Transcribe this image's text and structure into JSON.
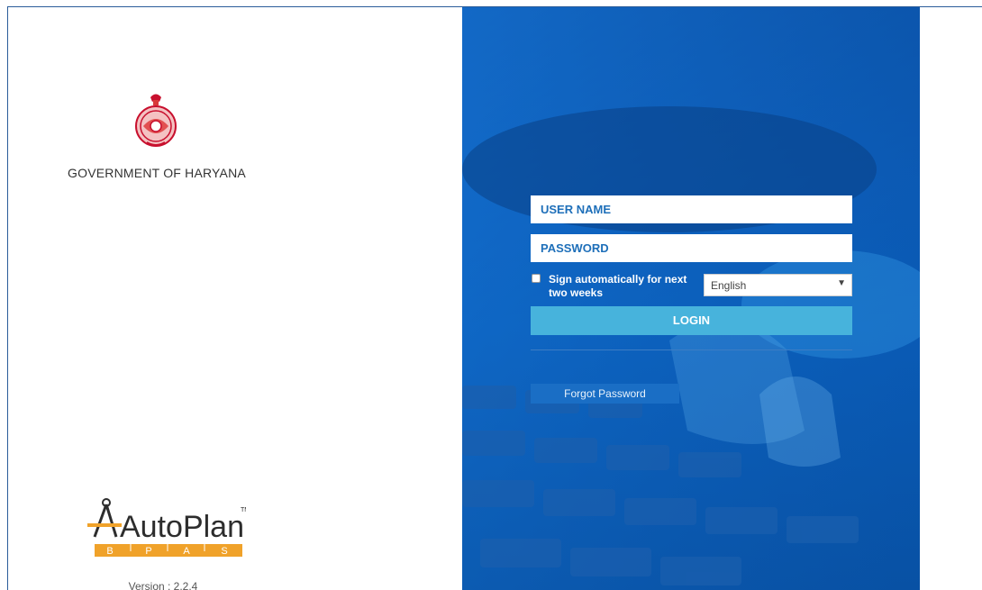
{
  "left": {
    "government_title": "GOVERNMENT OF HARYANA",
    "brand": "AutoPlan",
    "brand_trademark": "TM",
    "brand_subtitle": [
      "B",
      "P",
      "A",
      "S"
    ],
    "version": "Version : 2.2.4"
  },
  "login": {
    "username_placeholder": "USER NAME",
    "password_placeholder": "PASSWORD",
    "remember_label": "Sign automatically for next two weeks",
    "language_selected": "English",
    "login_label": "LOGIN",
    "forgot_label": "Forgot Password"
  },
  "colors": {
    "panel_blue": "#0b5cba",
    "login_button": "#47b3dc",
    "field_text": "#1e6fb9",
    "brand_orange": "#f0a22a"
  },
  "icons": {
    "emblem": "haryana-emblem-icon",
    "caret": "chevron-down-icon"
  }
}
